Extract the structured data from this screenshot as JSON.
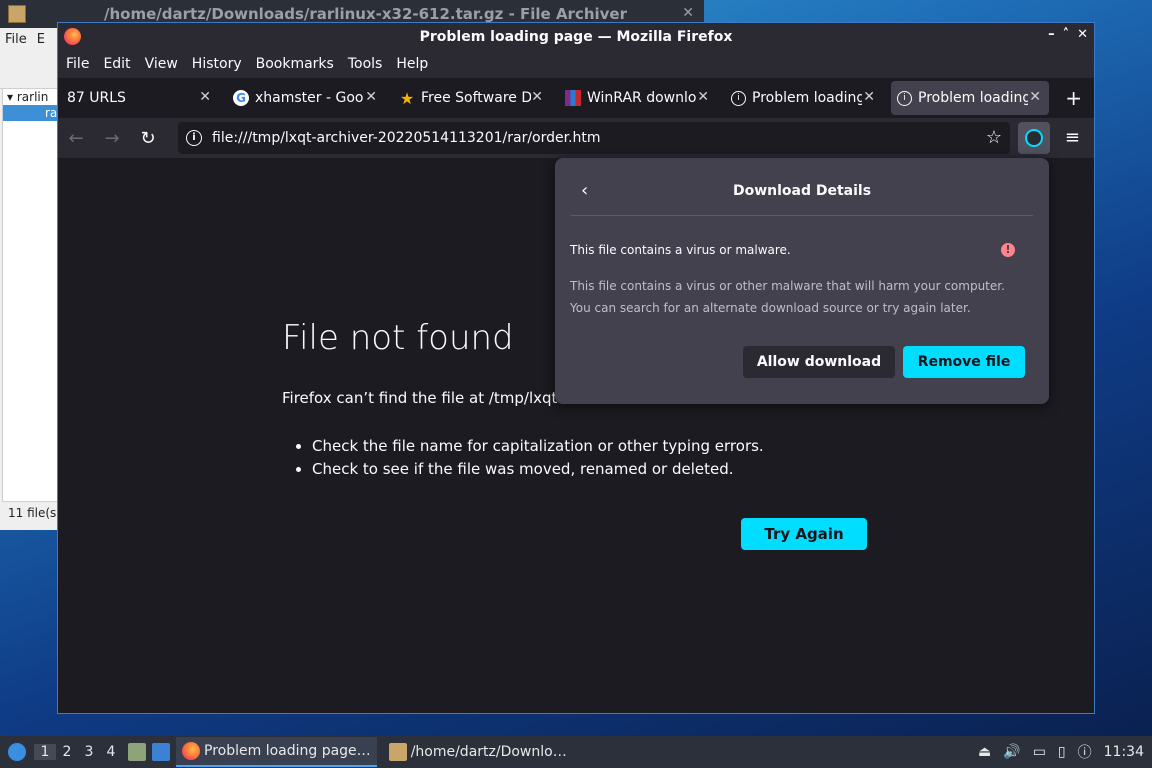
{
  "archiver": {
    "title": "/home/dartz/Downloads/rarlinux-x32-612.tar.gz - File Archiver",
    "menu": [
      "File",
      "E"
    ],
    "tree_items": [
      "rarlin",
      "ra"
    ],
    "status": "11 file(s"
  },
  "firefox": {
    "title": "Problem loading page — Mozilla Firefox",
    "window_controls": [
      "–",
      "˄",
      "✕"
    ],
    "menu": [
      "File",
      "Edit",
      "View",
      "History",
      "Bookmarks",
      "Tools",
      "Help"
    ],
    "tabs": [
      {
        "label": "87 URLS",
        "icon": "none",
        "active": false
      },
      {
        "label": "xhamster - Goo",
        "icon": "google-icon",
        "active": false
      },
      {
        "label": "Free Software D",
        "icon": "star-icon",
        "active": false
      },
      {
        "label": "WinRAR downlo",
        "icon": "winrar-icon",
        "active": false
      },
      {
        "label": "Problem loading",
        "icon": "info-icon",
        "active": false
      },
      {
        "label": "Problem loading",
        "icon": "info-icon",
        "active": true
      }
    ],
    "url": "file:///tmp/lxqt-archiver-20220514113201/rar/order.htm",
    "error": {
      "title": "File not found",
      "description": "Firefox can’t find the file at /tmp/lxqt",
      "bullets": [
        "Check the file name for capitalization or other typing errors.",
        "Check to see if the file was moved, renamed or deleted."
      ],
      "try_again": "Try Again"
    },
    "download_panel": {
      "title": "Download Details",
      "warning": "This file contains a virus or malware.",
      "detail_line1": "This file contains a virus or other malware that will harm your computer.",
      "detail_line2": "You can search for an alternate download source or try again later.",
      "allow_label": "Allow download",
      "remove_label": "Remove file",
      "accent": "#00ddff"
    }
  },
  "taskbar": {
    "desktops": [
      "1",
      "2",
      "3",
      "4"
    ],
    "tasks": [
      "Problem loading page…",
      "/home/dartz/Downlo…"
    ],
    "clock": "11:34"
  }
}
